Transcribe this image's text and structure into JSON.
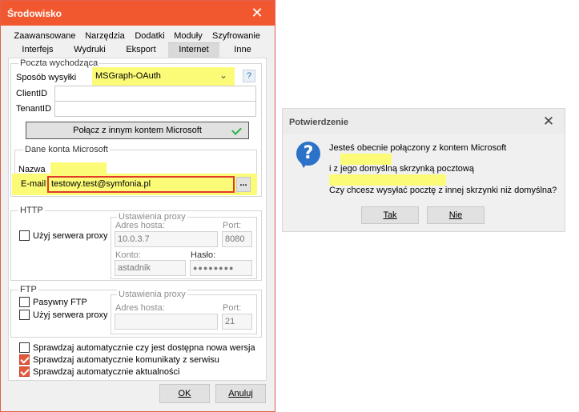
{
  "main": {
    "title": "Środowisko",
    "close": "✕",
    "tabs_row1": [
      "Zaawansowane",
      "Narzędzia",
      "Dodatki",
      "Moduły",
      "Szyfrowanie"
    ],
    "tabs_row2": [
      "Interfejs",
      "Wydruki",
      "Eksport",
      "Internet",
      "Inne"
    ],
    "active_tab": "Internet",
    "outgoing": {
      "group_title": "Poczta wychodząca",
      "method_label": "Sposób wysyłki",
      "method_value": "MSGraph-OAuth",
      "help": "?",
      "clientid_label": "ClientID",
      "clientid_value": "",
      "tenantid_label": "TenantID",
      "tenantid_value": "",
      "connect_button": "Połącz z innym kontem Microsoft"
    },
    "account": {
      "group_title": "Dane konta Microsoft",
      "name_label": "Nazwa",
      "email_label": "E-mail",
      "email_value": "testowy.test@symfonia.pl",
      "more_button": "..."
    },
    "http": {
      "group_title": "HTTP",
      "use_proxy_label": "Użyj serwera proxy",
      "use_proxy_checked": false,
      "proxy_title": "Ustawienia proxy",
      "host_label": "Adres hosta:",
      "host_value": "10.0.3.7",
      "port_label": "Port:",
      "port_value": "8080",
      "account_label": "Konto:",
      "account_value": "astadnik",
      "password_label": "Hasło:",
      "password_value": "●●●●●●●●"
    },
    "ftp": {
      "group_title": "FTP",
      "passive_label": "Pasywny FTP",
      "passive_checked": false,
      "use_proxy_label": "Użyj serwera proxy",
      "use_proxy_checked": false,
      "proxy_title": "Ustawienia proxy",
      "host_label": "Adres hosta:",
      "host_value": "",
      "port_label": "Port:",
      "port_value": "21"
    },
    "options": [
      {
        "label": "Sprawdzaj automatycznie czy jest dostępna nowa wersja",
        "checked": false
      },
      {
        "label": "Sprawdzaj automatycznie komunikaty z serwisu",
        "checked": true
      },
      {
        "label": "Sprawdzaj automatycznie aktualności",
        "checked": true
      }
    ],
    "ok_button": "OK",
    "cancel_button": "Anuluj"
  },
  "confirm": {
    "title": "Potwierdzenie",
    "close": "✕",
    "icon": "?",
    "line1": "Jesteś obecnie połączony z kontem Microsoft",
    "line2": "i z jego domyślną skrzynką pocztową",
    "line3": "Czy chcesz wysyłać pocztę z innej skrzynki niż domyślna?",
    "yes_button": "Tak",
    "no_button": "Nie"
  },
  "colors": {
    "title_bar": "#f2582f",
    "highlight": "#fbfb78",
    "highlight_border": "#e03a2a",
    "check_ok": "#2bb24c",
    "icon_blue": "#2c72c8"
  }
}
